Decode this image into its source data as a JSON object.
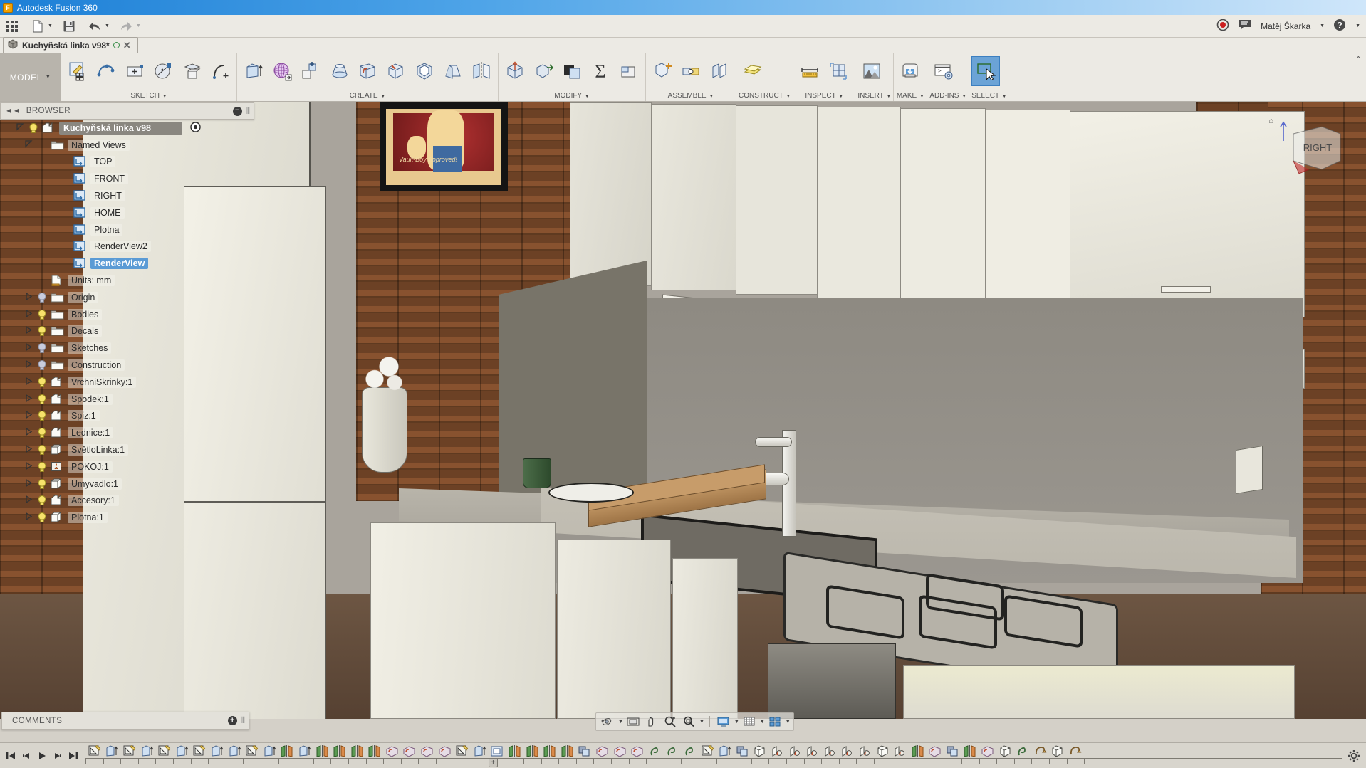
{
  "window": {
    "title": "Autodesk Fusion 360",
    "app_icon": "fusion-logo-icon"
  },
  "quick_access": {
    "grid_label": "show-data-panel",
    "new_label": "new-design",
    "save_label": "save",
    "undo_label": "undo",
    "redo_label": "redo",
    "record_label": "screen-record",
    "chat_label": "job-status",
    "user_name": "Matěj Škarka",
    "help_label": "help"
  },
  "tab": {
    "document_name": "Kuchyňská linka v98*",
    "close_label": "✕"
  },
  "ribbon": {
    "workspace": "MODEL",
    "groups": [
      {
        "label": "SKETCH",
        "buttons": [
          "create-sketch-icon",
          "line-icon",
          "rectangle-icon",
          "circle-icon",
          "sketch-plane-icon",
          "spline-icon"
        ]
      },
      {
        "label": "CREATE",
        "buttons": [
          "extrude-icon",
          "revolve-icon",
          "sweep-icon",
          "loft-icon",
          "fillet-icon",
          "chamfer-icon",
          "shell-icon",
          "draft-icon",
          "mirror-icon"
        ]
      },
      {
        "label": "MODIFY",
        "buttons": [
          "press-pull-icon",
          "move-copy-icon",
          "combine-icon",
          "sigma-icon",
          "scale-icon"
        ]
      },
      {
        "label": "ASSEMBLE",
        "buttons": [
          "new-component-icon",
          "joint-icon",
          "as-built-joint-icon"
        ]
      },
      {
        "label": "CONSTRUCT",
        "buttons": [
          "offset-plane-icon"
        ]
      },
      {
        "label": "INSPECT",
        "buttons": [
          "measure-icon",
          "section-analysis-icon"
        ]
      },
      {
        "label": "INSERT",
        "buttons": [
          "insert-decal-icon"
        ]
      },
      {
        "label": "MAKE",
        "buttons": [
          "3d-print-icon"
        ]
      },
      {
        "label": "ADD-INS",
        "buttons": [
          "scripts-addins-icon"
        ]
      },
      {
        "label": "SELECT",
        "buttons": [
          "select-cursor-icon"
        ],
        "selected": true
      }
    ],
    "collapse_label": "⌃"
  },
  "browser": {
    "title": "BROWSER",
    "collapse_label": "◄◄",
    "minus_label": "−",
    "tree": [
      {
        "label": "Kuchyňská linka v98",
        "level": 0,
        "kind": "root",
        "arrow": "open",
        "bulb": "on",
        "icon": "component-icon",
        "trailing": "document-settings-icon"
      },
      {
        "label": "Named Views",
        "level": 1,
        "kind": "folder",
        "arrow": "open",
        "bulb": "none",
        "icon": "folder-icon"
      },
      {
        "label": "TOP",
        "level": 2,
        "kind": "view",
        "arrow": "none",
        "bulb": "none",
        "icon": "named-view-icon"
      },
      {
        "label": "FRONT",
        "level": 2,
        "kind": "view",
        "arrow": "none",
        "bulb": "none",
        "icon": "named-view-icon"
      },
      {
        "label": "RIGHT",
        "level": 2,
        "kind": "view",
        "arrow": "none",
        "bulb": "none",
        "icon": "named-view-icon"
      },
      {
        "label": "HOME",
        "level": 2,
        "kind": "view",
        "arrow": "none",
        "bulb": "none",
        "icon": "named-view-icon"
      },
      {
        "label": "Plotna",
        "level": 2,
        "kind": "view",
        "arrow": "none",
        "bulb": "none",
        "icon": "named-view-icon"
      },
      {
        "label": "RenderView2",
        "level": 2,
        "kind": "view",
        "arrow": "none",
        "bulb": "none",
        "icon": "named-view-icon"
      },
      {
        "label": "RenderView",
        "level": 2,
        "kind": "view",
        "arrow": "none",
        "bulb": "none",
        "icon": "named-view-icon",
        "selected": true
      },
      {
        "label": "Units: mm",
        "level": 1,
        "kind": "units",
        "arrow": "none",
        "bulb": "none",
        "icon": "units-icon"
      },
      {
        "label": "Origin",
        "level": 1,
        "kind": "folder",
        "arrow": "closed",
        "bulb": "off",
        "icon": "folder-icon"
      },
      {
        "label": "Bodies",
        "level": 1,
        "kind": "folder",
        "arrow": "closed",
        "bulb": "on",
        "icon": "folder-icon"
      },
      {
        "label": "Decals",
        "level": 1,
        "kind": "folder",
        "arrow": "closed",
        "bulb": "on",
        "icon": "folder-icon"
      },
      {
        "label": "Sketches",
        "level": 1,
        "kind": "folder",
        "arrow": "closed",
        "bulb": "off",
        "icon": "folder-icon"
      },
      {
        "label": "Construction",
        "level": 1,
        "kind": "folder",
        "arrow": "closed",
        "bulb": "off",
        "icon": "folder-icon"
      },
      {
        "label": "VrchniSkrinky:1",
        "level": 1,
        "kind": "component",
        "arrow": "closed",
        "bulb": "on",
        "icon": "component-icon"
      },
      {
        "label": "Spodek:1",
        "level": 1,
        "kind": "component",
        "arrow": "closed",
        "bulb": "on",
        "icon": "component-icon"
      },
      {
        "label": "Spiz:1",
        "level": 1,
        "kind": "component",
        "arrow": "closed",
        "bulb": "on",
        "icon": "component-icon"
      },
      {
        "label": "Lednice:1",
        "level": 1,
        "kind": "component",
        "arrow": "closed",
        "bulb": "on",
        "icon": "component-icon"
      },
      {
        "label": "SvětloLinka:1",
        "level": 1,
        "kind": "body",
        "arrow": "closed",
        "bulb": "on",
        "icon": "body-icon"
      },
      {
        "label": "POKOJ:1",
        "level": 1,
        "kind": "component",
        "arrow": "closed",
        "bulb": "on",
        "icon": "appearance-icon"
      },
      {
        "label": "Umyvadlo:1",
        "level": 1,
        "kind": "body",
        "arrow": "closed",
        "bulb": "on",
        "icon": "body-icon"
      },
      {
        "label": "Accesory:1",
        "level": 1,
        "kind": "component",
        "arrow": "closed",
        "bulb": "on",
        "icon": "component-icon"
      },
      {
        "label": "Plotna:1",
        "level": 1,
        "kind": "body",
        "arrow": "closed",
        "bulb": "on",
        "icon": "body-icon"
      }
    ]
  },
  "comments": {
    "title": "COMMENTS",
    "plus_label": "+"
  },
  "navbar": {
    "buttons": [
      "orbit-icon",
      "look-at-icon",
      "pan-icon",
      "zoom-icon",
      "zoom-window-icon",
      "display-settings-icon",
      "grid-snap-icon",
      "viewports-icon"
    ]
  },
  "timeline": {
    "controls": [
      "skip-to-start-icon",
      "step-back-icon",
      "play-icon",
      "step-forward-icon",
      "skip-to-end-icon"
    ],
    "marker_label": "+",
    "settings_label": "timeline-settings-icon",
    "features": [
      "sketch",
      "extrude",
      "sketch",
      "extrude",
      "sketch",
      "extrude",
      "sketch",
      "extrude",
      "extrude",
      "sketch",
      "extrude",
      "mirror",
      "extrude",
      "mirror",
      "mirror",
      "mirror",
      "mirror",
      "fillet",
      "fillet",
      "fillet",
      "fillet",
      "sketch",
      "extrude",
      "pattern",
      "mirror",
      "mirror",
      "mirror",
      "mirror",
      "combine",
      "fillet",
      "fillet",
      "fillet",
      "thread",
      "thread",
      "thread",
      "sketch",
      "extrude",
      "combine",
      "body",
      "joint",
      "joint",
      "joint",
      "joint",
      "joint",
      "joint",
      "body",
      "joint",
      "mirror",
      "fillet",
      "combine",
      "mirror",
      "fillet",
      "shell",
      "thread",
      "revolve",
      "body",
      "revolve"
    ]
  },
  "viewport": {
    "view_cube_face": "RIGHT",
    "scene_name": "kitchen-render",
    "decal_poster_text": "Vault-Boy Approved!"
  },
  "colors": {
    "accent": "#5b9bd5",
    "ribbon_bg": "#eceae4",
    "panel_bg": "#e3e1da",
    "title_blue": "#1c7fd6",
    "brick": "#7b4a2a",
    "cabinet": "#e8e6dc",
    "counter": "#a9a49c"
  }
}
